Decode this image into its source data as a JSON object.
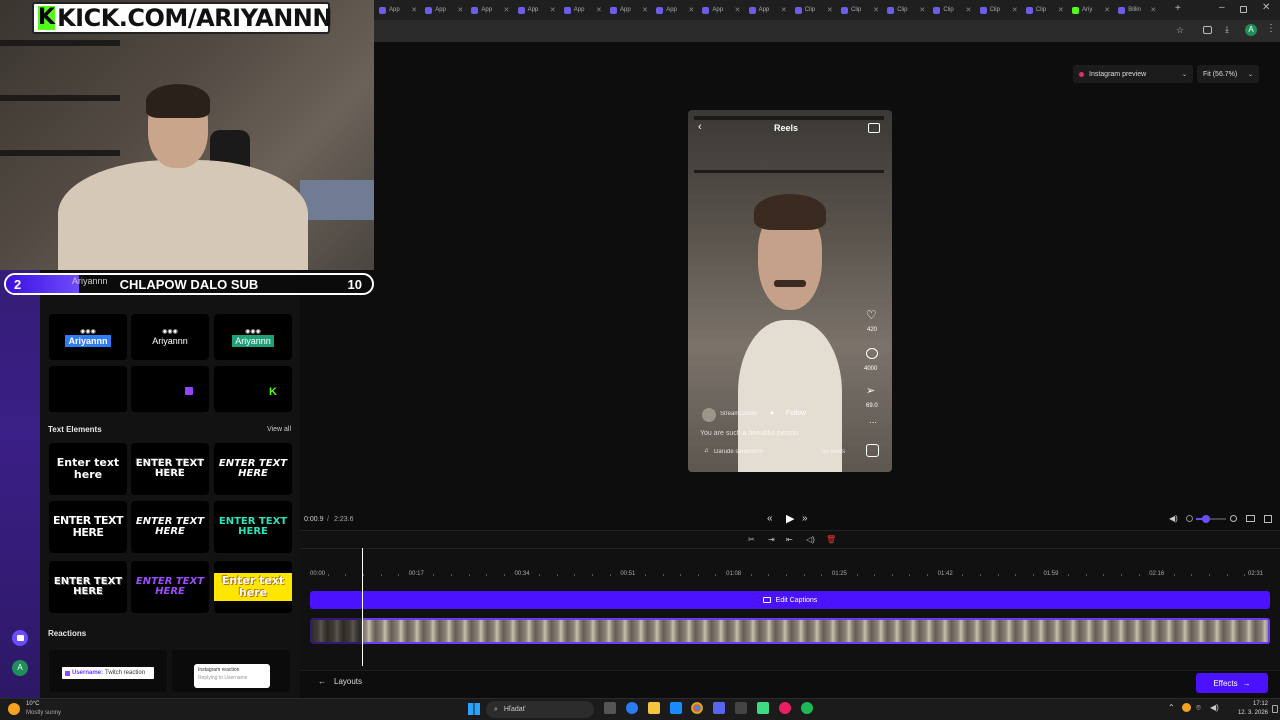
{
  "overlay": {
    "kick_banner": "KICK.COM/ARIYANNN",
    "sub_goal": {
      "current": "2",
      "title": "CHLAPOW DALO SUB",
      "target": "10",
      "progress": 0.2
    },
    "ghost_label": "Ariyannn"
  },
  "browser": {
    "tabs": [
      {
        "label": "App",
        "icon": "app-icon"
      },
      {
        "label": "App",
        "icon": "app-icon"
      },
      {
        "label": "App",
        "icon": "app-icon"
      },
      {
        "label": "App",
        "icon": "app-icon"
      },
      {
        "label": "App",
        "icon": "app-icon"
      },
      {
        "label": "App",
        "icon": "app-icon"
      },
      {
        "label": "App",
        "icon": "app-icon"
      },
      {
        "label": "App",
        "icon": "app-icon"
      },
      {
        "label": "App",
        "icon": "app-icon"
      },
      {
        "label": "Clip",
        "icon": "app-icon"
      },
      {
        "label": "Clip",
        "icon": "app-icon"
      },
      {
        "label": "Clip",
        "icon": "app-icon"
      },
      {
        "label": "Clip",
        "icon": "app-icon"
      },
      {
        "label": "Clip",
        "icon": "app-icon"
      },
      {
        "label": "Clip",
        "icon": "app-icon"
      },
      {
        "label": "Ariy",
        "icon": "kick-icon"
      },
      {
        "label": "Billin",
        "icon": "app-icon"
      }
    ],
    "new_tab": "+",
    "profile_letter": "A"
  },
  "panel": {
    "name_tiles": [
      "Ariyannn",
      "Ariyannn",
      "Ariyannn"
    ],
    "text_elements_label": "Text Elements",
    "view_all": "View all",
    "text_tiles": [
      "Enter text here",
      "ENTER TEXT HERE",
      "ENTER TEXT HERE",
      "ENTER TEXT HERE",
      "ENTER TEXT HERE",
      "ENTER TEXT HERE",
      "ENTER TEXT HERE",
      "ENTER TEXT HERE",
      "Enter text here"
    ],
    "reactions_label": "Reactions",
    "reaction_twitch_user": "Username:",
    "reaction_twitch": "Twitch reaction",
    "reaction_instagram": "Instagram reaction",
    "reaction_instagram_sub": "Replying to Username"
  },
  "editor": {
    "preview_dropdown": "Instagram preview",
    "zoom_dropdown": "Fit (56.7%)",
    "phone": {
      "header": "Reels",
      "likes": "420",
      "comments": "4000",
      "shares": "69.0",
      "username": "StreamLadder",
      "follow": "Follow",
      "caption": "You are such a beautiful person",
      "music": "Darude sandstorm",
      "users": "55 users"
    },
    "time_current": "0:00.9",
    "time_sep": "/",
    "time_total": "2:23.6",
    "ticks": [
      "00:00",
      "00:17",
      "00:34",
      "00:51",
      "01:08",
      "01:25",
      "01:42",
      "01:59",
      "02:16",
      "02:31"
    ],
    "caption_bar_label": "Edit Captions",
    "layouts_button": "Layouts",
    "effects_button": "Effects",
    "accent": "#4a12ff"
  },
  "taskbar": {
    "weather_temp": "10°C",
    "weather_desc": "Mostly sunny",
    "search": "Hľadať",
    "time": "17:12",
    "date": "12. 3. 2026"
  }
}
